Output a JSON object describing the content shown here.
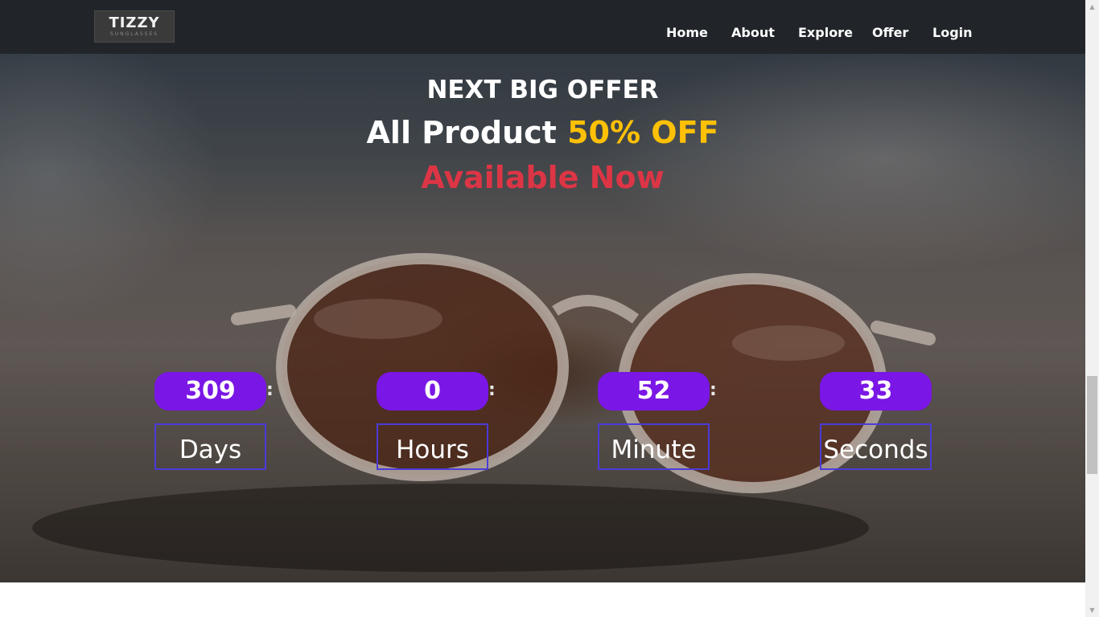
{
  "brand": {
    "name": "TIZZY",
    "tagline": "SUNGLASSES"
  },
  "nav": {
    "items": [
      {
        "label": "Home"
      },
      {
        "label": "About"
      },
      {
        "label": "Explore"
      },
      {
        "label": "Offer"
      },
      {
        "label": "Login"
      }
    ]
  },
  "hero": {
    "line1": "NEXT BIG OFFER",
    "line2_prefix": "All Product ",
    "line2_accent": "50% OFF",
    "line3": "Available Now",
    "background_image": "sunglasses-on-leather-seat"
  },
  "countdown": {
    "separator": ":",
    "units": [
      {
        "value": "309",
        "label": "Days"
      },
      {
        "value": "0",
        "label": "Hours"
      },
      {
        "value": "52",
        "label": "Minute"
      },
      {
        "value": "33",
        "label": "Seconds"
      }
    ]
  },
  "colors": {
    "navbar_bg": "#212529",
    "accent_yellow": "#ffc107",
    "accent_red": "#dc3545",
    "timer_bg": "#7a16e6",
    "timer_border": "#4b3bd8"
  }
}
